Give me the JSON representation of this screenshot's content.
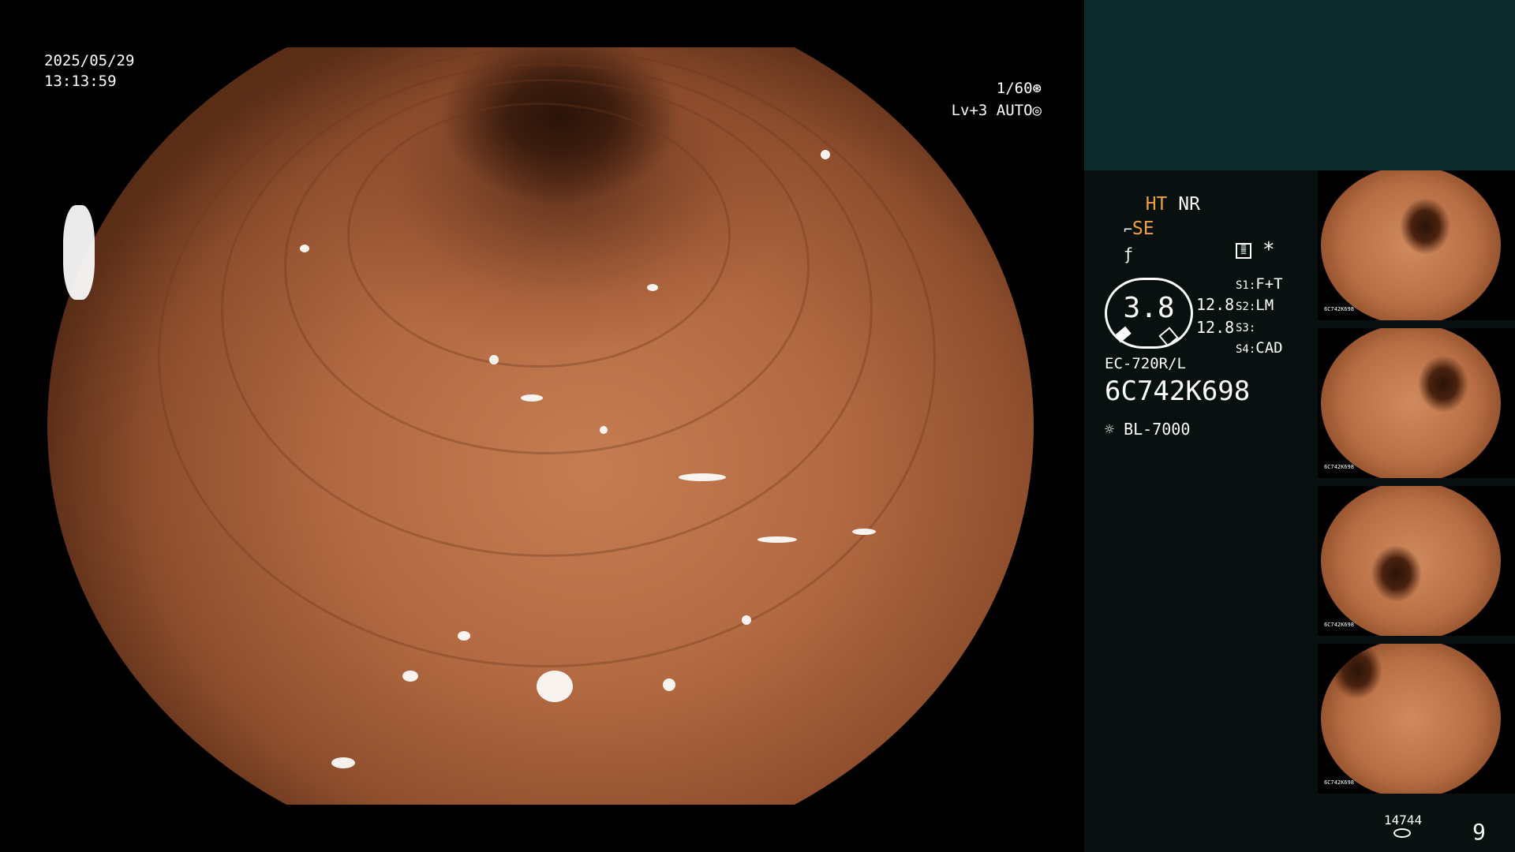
{
  "overlay": {
    "date": "2025/05/29",
    "time": "13:13:59",
    "shutter": "1/60",
    "shutter_icon": "aperture-icon",
    "level": "Lv+3 AUTO",
    "level_icon": "auto-iris-icon"
  },
  "panel": {
    "mode_ht": "HT",
    "mode_nr": "NR",
    "mode_se": "SE",
    "se_icon": "enhance-icon",
    "freeze_icon": "freeze-icon",
    "menu_icon": "menu-icon",
    "asterisk": "*",
    "gauge_value": "3.8",
    "readout_1": "12.8",
    "readout_2": "12.8",
    "switches": [
      {
        "key": "S1:",
        "value": "F+T"
      },
      {
        "key": "S2:",
        "value": "LM"
      },
      {
        "key": "S3:",
        "value": ""
      },
      {
        "key": "S4:",
        "value": "CAD"
      }
    ],
    "scope_model": "EC-720R/L",
    "scope_serial": "6C742K698",
    "light_icon": "sun-icon",
    "light_source": "BL-7000",
    "thumb_label": "6C742K698",
    "counter": "14744",
    "page_number": "9",
    "colors": {
      "accent": "#f0a03c",
      "panel_bg": "#081010",
      "panel_top": "#0c2b2b"
    }
  }
}
